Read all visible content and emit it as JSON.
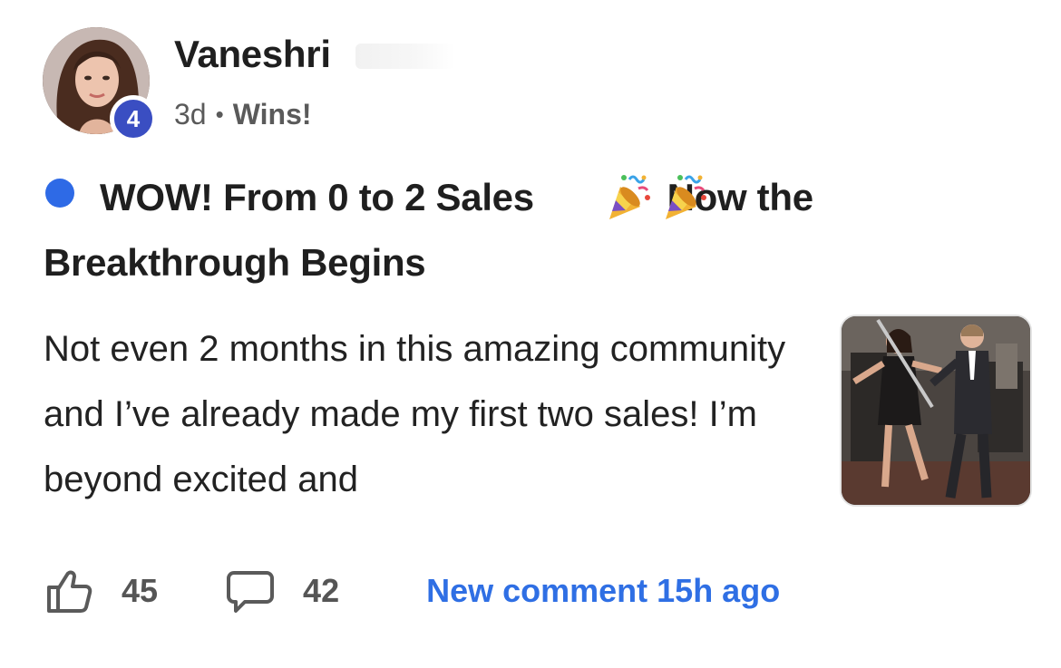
{
  "author": {
    "name": "Vaneshri",
    "level": "4",
    "avatar_icon": "profile-photo"
  },
  "meta": {
    "time": "3d",
    "separator": "•",
    "category": "Wins!"
  },
  "post": {
    "title_part1": "WOW! From 0 to 2 Sales",
    "title_emojis": [
      "party-popper-icon",
      "party-popper-icon"
    ],
    "title_part2": "Now the Breakthrough Begins",
    "body": "Not even 2 months in this amazing community and I’ve already made my first two sales! I’m beyond excited and",
    "unread_indicator_color": "#2e6ae6",
    "thumbnail": "celebration-gif"
  },
  "footer": {
    "likes": "45",
    "comments": "42",
    "new_comment_label": "New comment 15h ago"
  },
  "colors": {
    "accent": "#2f6fe4",
    "level_badge": "#3a4ec2",
    "text": "#1f1f1f",
    "muted": "#5a5a5a"
  }
}
